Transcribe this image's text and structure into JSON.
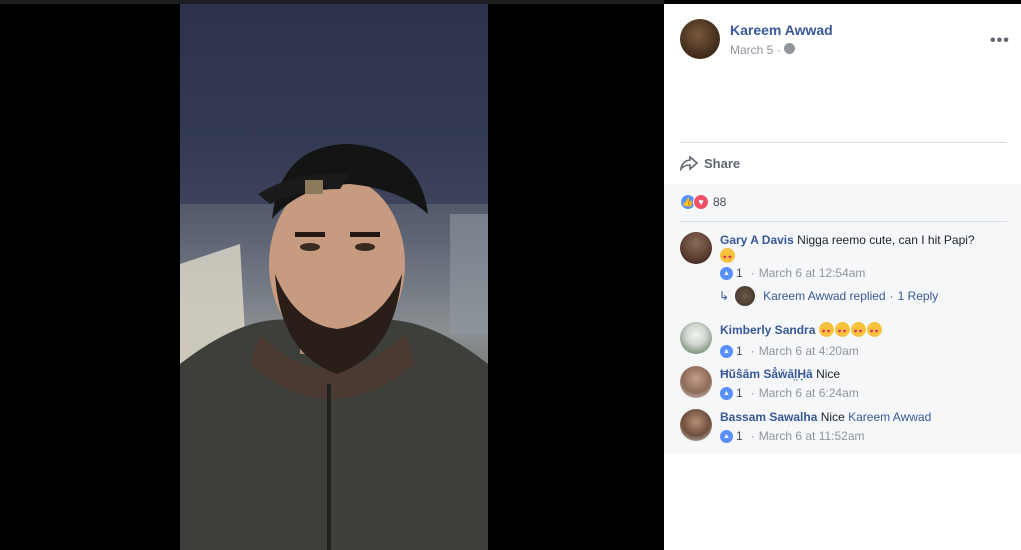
{
  "post": {
    "author": "Kareem Awwad",
    "date": "March 5",
    "date_sep": "·",
    "more_label": "•••",
    "share_label": "Share"
  },
  "reactions": {
    "count": "88",
    "like_glyph": "👍",
    "love_glyph": "♥"
  },
  "comments": [
    {
      "name": "Gary A Davis",
      "text": "Nigga reemo cute, can I hit Papi?",
      "likes": "1",
      "time": "March 6 at 12:54am",
      "emoji_count": 1
    },
    {
      "name": "Kimberly Sandra",
      "text": "",
      "likes": "1",
      "time": "March 6 at 4:20am",
      "emoji_count": 4
    },
    {
      "name": "Ħŭŝām Sẳẅāl̤Ḥā",
      "text": "Nice",
      "likes": "1",
      "time": "March 6 at 6:24am"
    },
    {
      "name": "Bassam Sawalha",
      "text": "Nice",
      "mention": "Kareem Awwad",
      "likes": "1",
      "time": "March 6 at 11:52am"
    }
  ],
  "reply": {
    "arrow": "↳",
    "text": "Kareem Awwad replied",
    "dot": "·",
    "count_label": "1 Reply"
  },
  "meta": {
    "dot": "·"
  },
  "icons": {
    "globe": "globe-icon",
    "share": "share-icon",
    "more": "more-options-icon",
    "like": "like-icon",
    "love": "love-icon",
    "emoji": "heart-eyes-emoji-icon"
  },
  "colors": {
    "link": "#385898",
    "meta": "#90949c",
    "like": "#5890ff",
    "love": "#f25268"
  }
}
